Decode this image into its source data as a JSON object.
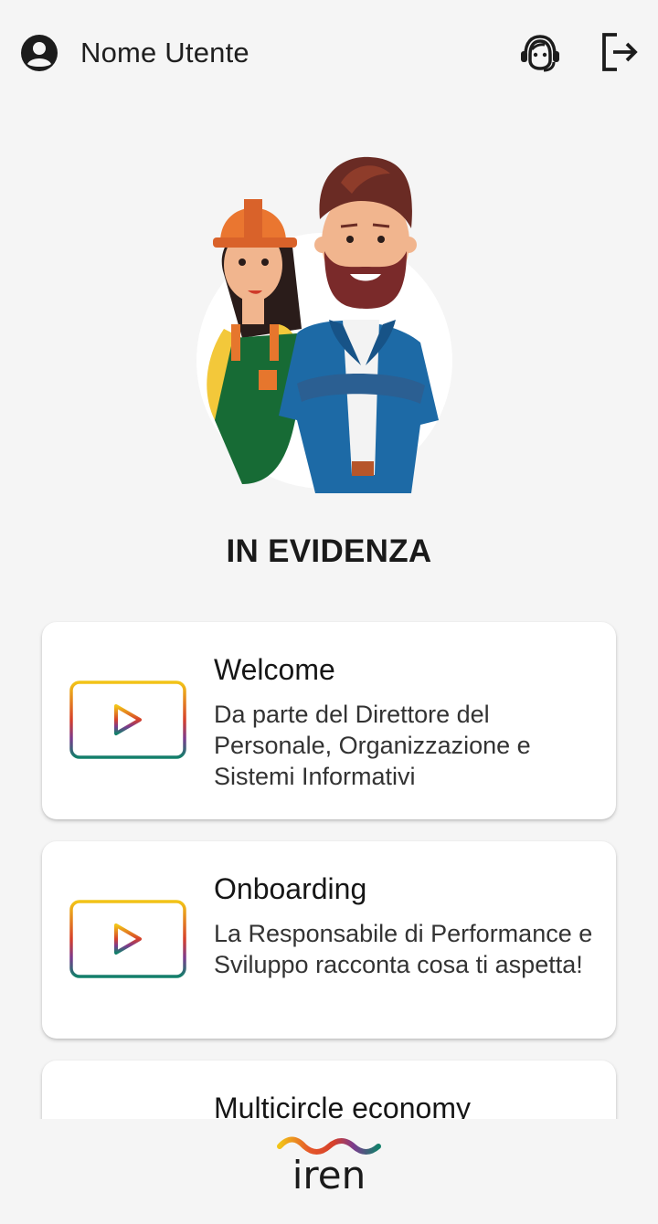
{
  "header": {
    "user_name": "Nome Utente"
  },
  "section": {
    "title": "IN EVIDENZA"
  },
  "cards": [
    {
      "title": "Welcome",
      "description": "Da parte del Direttore del Personale, Organizzazione e Sistemi Informativi"
    },
    {
      "title": "Onboarding",
      "description": "La Responsabile di Performance e Sviluppo racconta cosa ti aspetta!"
    },
    {
      "title": "Multicircle economy",
      "description": ""
    }
  ],
  "footer": {
    "logo_text": "iren"
  },
  "icons": {
    "user": "account-circle-icon",
    "support": "headset-icon",
    "logout": "logout-icon",
    "video": "play-video-icon"
  },
  "colors": {
    "background": "#f5f5f5",
    "card": "#ffffff",
    "play_red": "#d6402b",
    "gradient_top": "#f2c417",
    "gradient_bottom": "#12806a"
  }
}
